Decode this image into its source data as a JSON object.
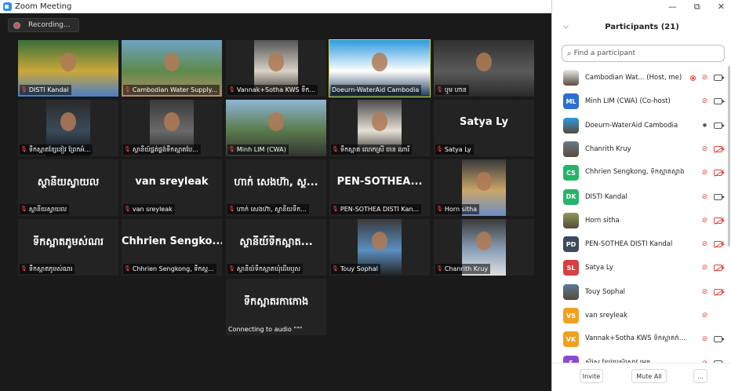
{
  "window": {
    "title": "Zoom Meeting"
  },
  "recording": {
    "label": "Recording..."
  },
  "tiles": [
    {
      "name": "DISTI Kandal",
      "muted": true,
      "kind": "video",
      "colors": [
        "#3a6e3a",
        "#caa83a",
        "#4a7ec6"
      ]
    },
    {
      "name": "Cambodian Water Supply...",
      "muted": true,
      "kind": "video",
      "colors": [
        "#6ea3c7",
        "#5e8a4a",
        "#b48c6a"
      ]
    },
    {
      "name": "Vannak+Sotha KWS ទឹក...",
      "muted": true,
      "kind": "video",
      "colors": [
        "#555",
        "#d9d2c5",
        "#222"
      ]
    },
    {
      "name": "Doeurn-WaterAid Cambodia",
      "muted": false,
      "kind": "video",
      "active": true,
      "colors": [
        "#2c9be0",
        "#ffffff",
        "#1a3a5a"
      ]
    },
    {
      "name": "ឬម ហាន",
      "muted": true,
      "kind": "video",
      "colors": [
        "#303030",
        "#5a5a5a",
        "#2a2a2a"
      ]
    },
    {
      "name": "ទឹកស្អាតខ្សែនៀវ ព្រែកអំ...",
      "muted": true,
      "kind": "video",
      "colors": [
        "#2a2a2a",
        "#3a4a5a",
        "#111"
      ]
    },
    {
      "name": "ស្ថានីយ៍ផ្គត់ផ្គង់ទឹកស្អាតបែ...",
      "muted": true,
      "kind": "video",
      "colors": [
        "#3a3a3a",
        "#6a6a6a",
        "#222"
      ]
    },
    {
      "name": "Minh LIM (CWA)",
      "muted": true,
      "kind": "video",
      "colors": [
        "#8fb6d6",
        "#5a7a4a",
        "#333"
      ]
    },
    {
      "name": "ទឹកស្អាត លោកស្រី ចាន ណារី",
      "muted": true,
      "kind": "video",
      "colors": [
        "#4a4a4a",
        "#e6e0d6",
        "#222"
      ]
    },
    {
      "name": "Satya Ly",
      "muted": true,
      "kind": "text",
      "big": "Satya Ly"
    },
    {
      "name": "ស្ថានីយស្វាយល",
      "muted": true,
      "kind": "text",
      "big": "ស្ថានីយស្វាយល"
    },
    {
      "name": "van sreyleak",
      "muted": true,
      "kind": "text",
      "big": "van sreyleak"
    },
    {
      "name": "ហាក់ សេងហ៊ា, ស្ថានីយទឹក...",
      "muted": true,
      "kind": "text",
      "big": "ហាក់ សេងហ៊ា, ស្ថ..."
    },
    {
      "name": "PEN-SOTHEA DISTI Kan...",
      "muted": true,
      "kind": "text",
      "big": "PEN-SOTHEA..."
    },
    {
      "name": "Horn sitha",
      "muted": true,
      "kind": "video",
      "colors": [
        "#3a3a3a",
        "#c9a66a",
        "#6a8ec8"
      ]
    },
    {
      "name": "ទឹកស្អាតភូមស់ណរ",
      "muted": true,
      "kind": "text",
      "big": "ទឹកស្អាតភូមស់ណរ"
    },
    {
      "name": "Chhrien Sengkong, ទឹកស្អ...",
      "muted": true,
      "kind": "text",
      "big": "Chhrien Sengko..."
    },
    {
      "name": "ស្ថានីយ៍ទឹកស្អាតឃុំដើមឫស",
      "muted": true,
      "kind": "text",
      "big": "ស្ថានីយ៍ទឹកស្អាត..."
    },
    {
      "name": "Touy Sophal",
      "muted": true,
      "kind": "video",
      "colors": [
        "#3a3a3a",
        "#5a8ec0",
        "#222"
      ]
    },
    {
      "name": "Chanrith Kruy",
      "muted": true,
      "kind": "video",
      "colors": [
        "#3a3a3a",
        "#8aa0b8",
        "#e0e0e0"
      ]
    },
    {
      "name": "",
      "muted": false,
      "kind": "connecting",
      "big": "ទឹកស្អាតរកាកោង",
      "status": "Connecting to audio \"\"\""
    }
  ],
  "panel": {
    "title": "Participants (21)",
    "search_placeholder": "Find a participant",
    "window_controls": {
      "minimize": "—",
      "restore": "⧉",
      "close": "✕"
    },
    "participants": [
      {
        "name": "Cambodian Wat... (Host, me)",
        "initials": "",
        "avatar_color": "#e8e8e8",
        "photo": true,
        "mic": "muted",
        "cam": "on",
        "recording": true
      },
      {
        "name": "Minh LIM (CWA) (Co-host)",
        "initials": "ML",
        "avatar_color": "#2d6fd0",
        "mic": "muted",
        "cam": "on"
      },
      {
        "name": "Doeurn-WaterAid Cambodia",
        "initials": "",
        "avatar_color": "#2c9be0",
        "photo": true,
        "mic": "on",
        "cam": "on"
      },
      {
        "name": "Chanrith Kruy",
        "initials": "",
        "avatar_color": "#6a7a8a",
        "photo": true,
        "mic": "muted",
        "cam": "off"
      },
      {
        "name": "Chhrien Sengkong, ទឹកស្អាតស្វាង",
        "initials": "CS",
        "avatar_color": "#27b469",
        "mic": "muted",
        "cam": "off"
      },
      {
        "name": "DISTI Kandal",
        "initials": "DK",
        "avatar_color": "#27b469",
        "mic": "muted",
        "cam": "on"
      },
      {
        "name": "Horn sitha",
        "initials": "",
        "avatar_color": "#8a9a5a",
        "photo": true,
        "mic": "muted",
        "cam": "off"
      },
      {
        "name": "PEN-SOTHEA DISTI Kandal",
        "initials": "PD",
        "avatar_color": "#3c4a5c",
        "mic": "muted",
        "cam": "off"
      },
      {
        "name": "Satya Ly",
        "initials": "SL",
        "avatar_color": "#d64040",
        "mic": "muted",
        "cam": "off"
      },
      {
        "name": "Touy Sophal",
        "initials": "",
        "avatar_color": "#5a7a9a",
        "photo": true,
        "mic": "muted",
        "cam": "off"
      },
      {
        "name": "van sreyleak",
        "initials": "VS",
        "avatar_color": "#f0a020",
        "mic": "muted",
        "cam": "none"
      },
      {
        "name": "Vannak+Sotha KWS ទឹកស្អាតកំ...",
        "initials": "VK",
        "avatar_color": "#f0a020",
        "mic": "muted",
        "cam": "on"
      },
      {
        "name": "ស៊ីរ៉ូស ខ្សែរ៉ូយស៊ីស្រាវ អេក្ត",
        "initials": "S",
        "avatar_color": "#8a4ad0",
        "mic": "muted",
        "cam": "on"
      }
    ],
    "buttons": {
      "invite": "Invite",
      "mute_all": "Mute All",
      "more": "..."
    }
  },
  "colors": {
    "active_speaker": "#d3e31f",
    "muted_red": "#e0463c",
    "accent": "#2d8cff"
  }
}
